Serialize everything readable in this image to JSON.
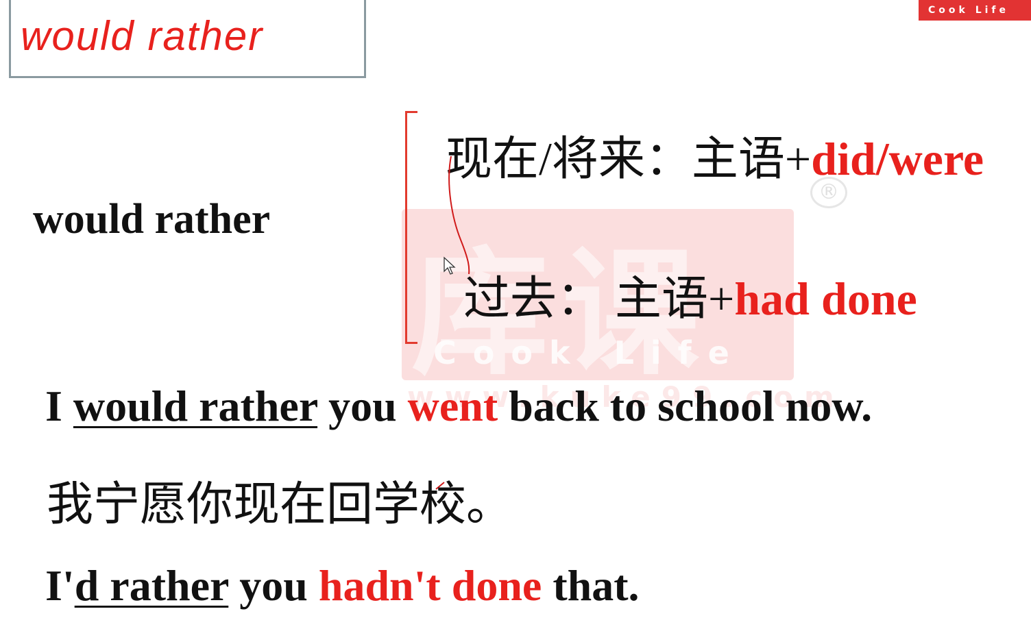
{
  "title": "would rather",
  "logo": {
    "badge_text": "Cook Life",
    "watermark_glyphs": "库课",
    "watermark_text": "Cook Life",
    "watermark_url": "www.kuke99.com",
    "registered": "®"
  },
  "label": "would rather",
  "rules": {
    "present": {
      "prefix": "现在/将来：主语+",
      "form": "did/were"
    },
    "past": {
      "prefix": "过去：  主语+",
      "form": "had done"
    }
  },
  "examples": [
    {
      "pre": "I ",
      "underlined": "would rather",
      "mid": " you ",
      "highlight": "went",
      "post": " back to school now."
    },
    {
      "pre": "I'",
      "underlined": "d rather",
      "mid": " you ",
      "highlight": "hadn't done",
      "post": " that."
    }
  ],
  "translations": [
    "我宁愿你现在回学校。"
  ],
  "colors": {
    "accent": "#e8211d",
    "text": "#111111",
    "box_border": "#8a9aa0"
  }
}
